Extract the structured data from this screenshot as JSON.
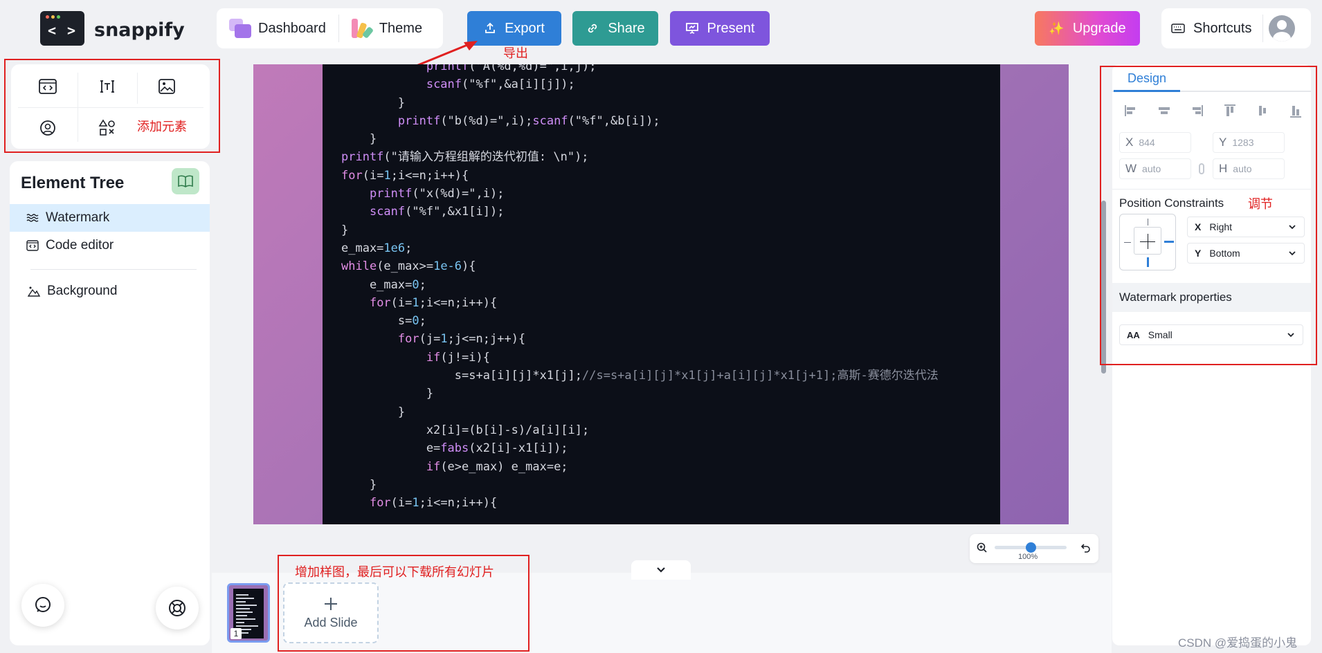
{
  "app": {
    "brand": "snappify",
    "logo_glyph": "< >"
  },
  "nav": {
    "dashboard": "Dashboard",
    "theme": "Theme"
  },
  "actions": {
    "export": "Export",
    "share": "Share",
    "present": "Present",
    "upgrade": "Upgrade",
    "shortcuts": "Shortcuts"
  },
  "colors": {
    "export": "#2f7fd7",
    "share": "#2e9b93",
    "present": "#7e55dd",
    "accent": "#2f7fd7",
    "annotation": "#e02020"
  },
  "annotations": {
    "export_label": "导出",
    "add_elements": "添加元素",
    "adjust": "调节",
    "add_slide_note": "增加样图，最后可以下载所有幻灯片"
  },
  "add_elements": {
    "icons": [
      "code-block-icon",
      "text-icon",
      "image-icon",
      "avatar-icon",
      "shapes-icon"
    ]
  },
  "element_tree": {
    "title": "Element Tree",
    "items": [
      {
        "label": "Watermark",
        "icon": "waves-icon"
      },
      {
        "label": "Code editor",
        "icon": "code-editor-icon"
      },
      {
        "label": "Background",
        "icon": "mountain-icon"
      }
    ]
  },
  "code_lines": [
    "            printf(\"A(%d,%d)=\",i,j);",
    "            scanf(\"%f\",&a[i][j]);",
    "        }",
    "        printf(\"b(%d)=\",i);scanf(\"%f\",&b[i]);",
    "    }",
    "printf(\"请输入方程组解的迭代初值: \\n\");",
    "for(i=1;i<=n;i++){",
    "    printf(\"x(%d)=\",i);",
    "    scanf(\"%f\",&x1[i]);",
    "}",
    "e_max=1e6;",
    "while(e_max>=1e-6){",
    "    e_max=0;",
    "    for(i=1;i<=n;i++){",
    "        s=0;",
    "        for(j=1;j<=n;j++){",
    "            if(j!=i){",
    "                s=s+a[i][j]*x1[j];//s=s+a[i][j]*x1[j]+a[i][j]*x1[j+1];高斯-赛德尔迭代法",
    "            }",
    "        }",
    "            x2[i]=(b[i]-s)/a[i][i];",
    "            e=fabs(x2[i]-x1[i]);",
    "            if(e>e_max) e_max=e;",
    "    }",
    "    for(i=1;i<=n;i++){"
  ],
  "zoom": {
    "label": "100%",
    "value": 0.5
  },
  "slides": {
    "current_number": "1",
    "add_label": "Add Slide"
  },
  "design_panel": {
    "tab": "Design",
    "x_label": "X",
    "x_value": "844",
    "y_label": "Y",
    "y_value": "1283",
    "w_label": "W",
    "w_value": "auto",
    "h_label": "H",
    "h_value": "auto",
    "position_constraints": "Position Constraints",
    "constraint_x_label": "X",
    "constraint_x": "Right",
    "constraint_y_label": "Y",
    "constraint_y": "Bottom",
    "watermark_properties": "Watermark properties",
    "size_icon_label": "AA",
    "size_value": "Small"
  },
  "footer_watermark": "CSDN @爱捣蛋的小鬼"
}
